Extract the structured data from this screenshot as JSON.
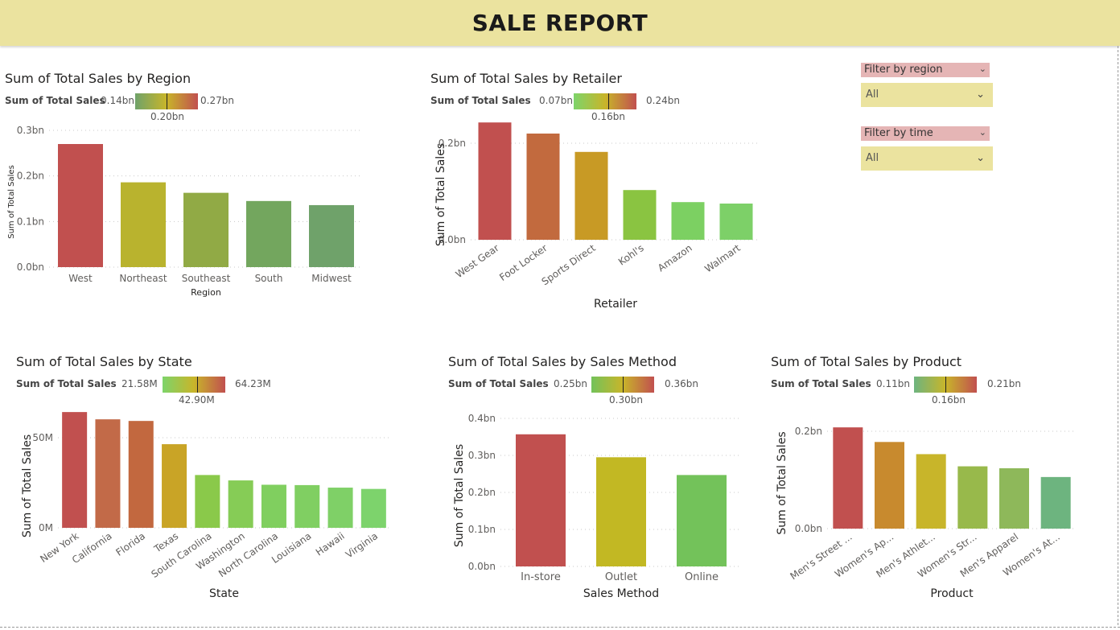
{
  "report_title": "SALE REPORT",
  "filters": [
    {
      "label": "Filter by region",
      "value": "All"
    },
    {
      "label": "Filter by time",
      "value": "All"
    }
  ],
  "chart_data": [
    {
      "id": "region",
      "type": "bar",
      "title": "Sum of Total Sales by Region",
      "xlabel": "Region",
      "ylabel": "Sum of Total Sales",
      "categories": [
        "West",
        "Northeast",
        "Southeast",
        "South",
        "Midwest"
      ],
      "values": [
        0.27,
        0.186,
        0.163,
        0.145,
        0.136
      ],
      "ylim": [
        0,
        0.3
      ],
      "yticks": [
        0,
        0.1,
        0.2,
        0.3
      ],
      "ytick_labels": [
        "0.0bn",
        "0.1bn",
        "0.2bn",
        "0.3bn"
      ],
      "tick_rotation": 0,
      "colors": [
        "#c1504f",
        "#b9b32e",
        "#91aa45",
        "#73a65e",
        "#6fa26a"
      ],
      "legend": {
        "label": "Sum of Total Sales",
        "min": "0.14bn",
        "max": "0.27bn",
        "mid": "0.20bn",
        "mid_frac": 0.5,
        "stops": [
          "#6fa26a",
          "#c8b52a",
          "#c1504f"
        ]
      }
    },
    {
      "id": "retailer",
      "type": "bar",
      "title": "Sum of Total Sales by Retailer",
      "xlabel": "Retailer",
      "ylabel": "Sum of Total Sales",
      "categories": [
        "West Gear",
        "Foot Locker",
        "Sports Direct",
        "Kohl's",
        "Amazon",
        "Walmart"
      ],
      "values": [
        0.243,
        0.22,
        0.182,
        0.103,
        0.078,
        0.075
      ],
      "ylim": [
        0,
        0.25
      ],
      "yticks": [
        0,
        0.2
      ],
      "ytick_labels": [
        "0.0bn",
        "0.2bn"
      ],
      "tick_rotation": -35,
      "colors": [
        "#c1504f",
        "#c26a3e",
        "#c89a25",
        "#8ac441",
        "#7cd062",
        "#7dd068"
      ],
      "legend": {
        "label": "Sum of Total Sales",
        "min": "0.07bn",
        "max": "0.24bn",
        "mid": "0.16bn",
        "mid_frac": 0.55,
        "stops": [
          "#7dd46a",
          "#c8b52a",
          "#c1504f"
        ]
      }
    },
    {
      "id": "state",
      "type": "bar",
      "title": "Sum of Total Sales by State",
      "xlabel": "State",
      "ylabel": "Sum of Total Sales",
      "categories": [
        "New York",
        "California",
        "Florida",
        "Texas",
        "South Carolina",
        "Washington",
        "North Carolina",
        "Louisiana",
        "Hawaii",
        "Virginia"
      ],
      "values": [
        64.23,
        60.2,
        59.3,
        46.4,
        29.3,
        26.3,
        23.9,
        23.7,
        22.3,
        21.58
      ],
      "ylim": [
        0,
        90
      ],
      "yticks": [
        0,
        50
      ],
      "ytick_labels": [
        "0M",
        "50M"
      ],
      "tick_rotation": -35,
      "colors": [
        "#c1504f",
        "#c26a48",
        "#c2683f",
        "#c9a426",
        "#8ac94a",
        "#86cc56",
        "#80cf5f",
        "#80cf62",
        "#7fd067",
        "#7dd36c"
      ],
      "legend": {
        "label": "Sum of Total Sales",
        "min": "21.58M",
        "max": "64.23M",
        "mid": "42.90M",
        "mid_frac": 0.55,
        "stops": [
          "#7dd46a",
          "#c8b52a",
          "#c1504f"
        ]
      }
    },
    {
      "id": "method",
      "type": "bar",
      "title": "Sum of Total Sales by Sales Method",
      "xlabel": "Sales Method",
      "ylabel": "Sum of Total Sales",
      "categories": [
        "In-store",
        "Outlet",
        "Online"
      ],
      "values": [
        0.357,
        0.295,
        0.247
      ],
      "ylim": [
        0,
        0.4
      ],
      "yticks": [
        0,
        0.1,
        0.2,
        0.3,
        0.4
      ],
      "ytick_labels": [
        "0.0bn",
        "0.1bn",
        "0.2bn",
        "0.3bn",
        "0.4bn"
      ],
      "tick_rotation": 0,
      "colors": [
        "#c1504f",
        "#c2b823",
        "#73c25a"
      ],
      "legend": {
        "label": "Sum of Total Sales",
        "min": "0.25bn",
        "max": "0.36bn",
        "mid": "0.30bn",
        "mid_frac": 0.5,
        "stops": [
          "#73c25a",
          "#c8b52a",
          "#c1504f"
        ]
      }
    },
    {
      "id": "product",
      "type": "bar",
      "title": "Sum of Total Sales by Product",
      "xlabel": "Product",
      "ylabel": "Sum of Total Sales",
      "categories": [
        "Men's Street ...",
        "Women's Ap...",
        "Men's Athlet...",
        "Women's Str...",
        "Men's Apparel",
        "Women's At..."
      ],
      "values": [
        0.208,
        0.178,
        0.153,
        0.128,
        0.124,
        0.106
      ],
      "ylim": [
        0,
        0.25
      ],
      "yticks": [
        0,
        0.2
      ],
      "ytick_labels": [
        "0.0bn",
        "0.2bn"
      ],
      "tick_rotation": -35,
      "colors": [
        "#c1504f",
        "#c88a2e",
        "#c8b52a",
        "#98b94b",
        "#8eb85a",
        "#6db47f"
      ],
      "legend": {
        "label": "Sum of Total Sales",
        "min": "0.11bn",
        "max": "0.21bn",
        "mid": "0.16bn",
        "mid_frac": 0.5,
        "stops": [
          "#6db47f",
          "#c8b52a",
          "#c1504f"
        ]
      }
    }
  ]
}
